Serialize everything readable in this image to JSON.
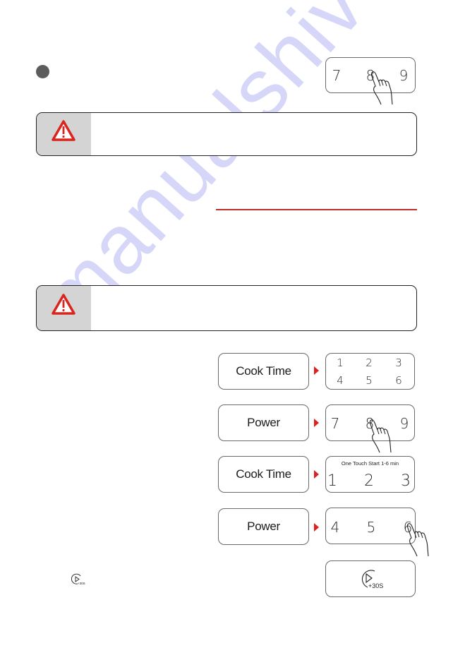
{
  "step_bullet": {
    "icon": "filled-circle-bullet",
    "color": "#5c5c5c"
  },
  "intro_keypad": {
    "digits": [
      "7",
      "8",
      "9"
    ],
    "pressed": "8"
  },
  "warnings": [
    {
      "icon": "warning-triangle-icon",
      "text": ""
    },
    {
      "icon": "warning-triangle-icon",
      "text": ""
    }
  ],
  "accent_color": "#e02020",
  "divider_color": "#bf2e2a",
  "steps": [
    {
      "button_label": "Cook Time",
      "keypad": {
        "caption": "",
        "rows": [
          [
            "1",
            "2",
            "3"
          ],
          [
            "4",
            "5",
            "6"
          ]
        ],
        "pressed": ""
      }
    },
    {
      "button_label": "Power",
      "keypad": {
        "caption": "",
        "rows": [
          [
            "7",
            "8",
            "9"
          ]
        ],
        "pressed": "8"
      }
    },
    {
      "button_label": "Cook Time",
      "keypad": {
        "caption": "One Touch Start 1-6 min",
        "rows": [
          [
            "1",
            "2",
            "3"
          ]
        ],
        "pressed": ""
      }
    },
    {
      "button_label": "Power",
      "keypad": {
        "caption": "",
        "rows": [
          [
            "4",
            "5",
            "6"
          ]
        ],
        "pressed": "6"
      }
    }
  ],
  "start_button": {
    "icon": "play-plus-30s-icon",
    "label": "+30S"
  },
  "inline_icon": {
    "icon": "play-plus-30s-icon",
    "label": "+30S"
  },
  "watermark": "manualshive.com"
}
